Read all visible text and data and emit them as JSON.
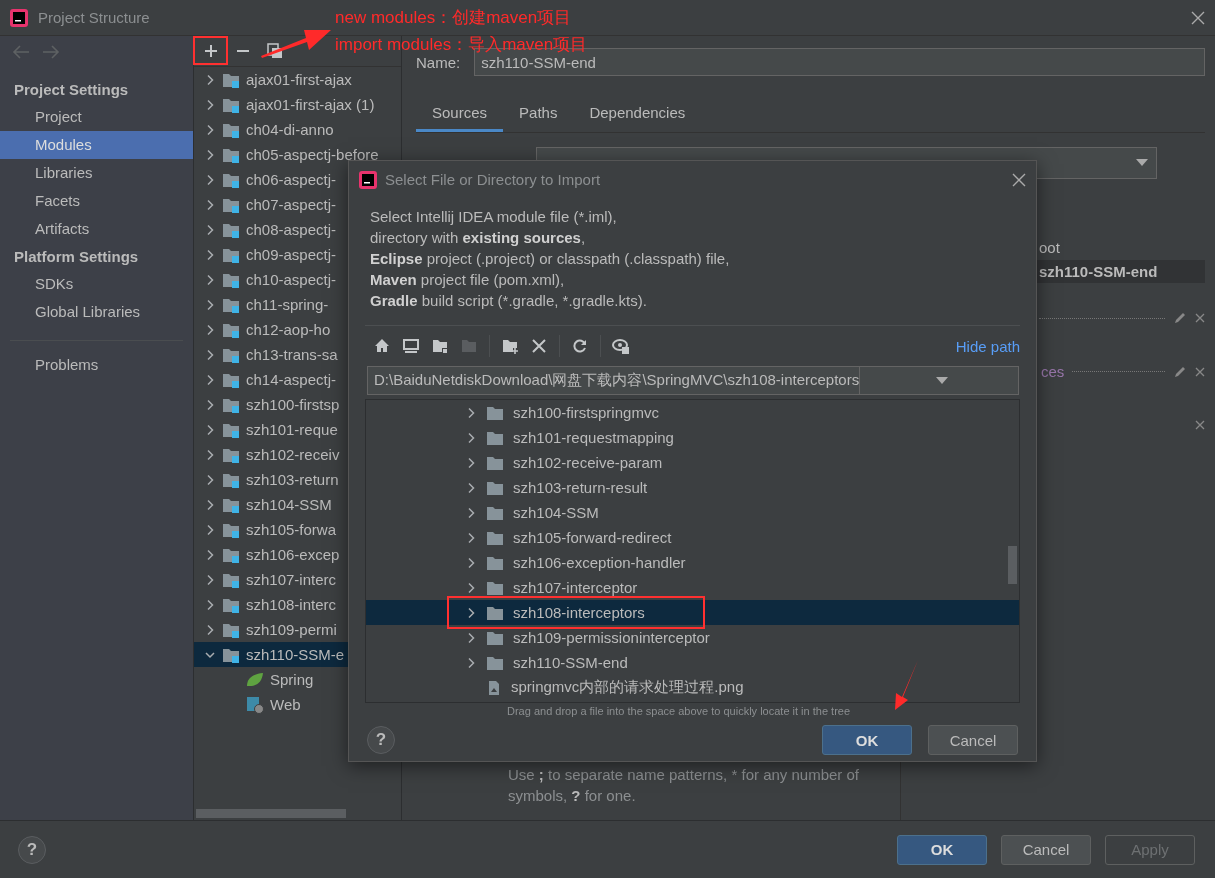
{
  "window": {
    "title": "Project Structure"
  },
  "annotations": [
    "new modules：创建maven项目",
    "import modules：导入maven项目"
  ],
  "sidebar": {
    "groups": [
      {
        "heading": "Project Settings",
        "items": [
          {
            "label": "Project",
            "selected": false
          },
          {
            "label": "Modules",
            "selected": true
          },
          {
            "label": "Libraries",
            "selected": false
          },
          {
            "label": "Facets",
            "selected": false
          },
          {
            "label": "Artifacts",
            "selected": false
          }
        ]
      },
      {
        "heading": "Platform Settings",
        "items": [
          {
            "label": "SDKs",
            "selected": false
          },
          {
            "label": "Global Libraries",
            "selected": false
          }
        ]
      }
    ],
    "footer_items": [
      {
        "label": "Problems",
        "selected": false
      }
    ]
  },
  "module_tree": {
    "items": [
      {
        "label": "ajax01-first-ajax",
        "expanded": false,
        "selected": false
      },
      {
        "label": "ajax01-first-ajax (1)",
        "expanded": false,
        "selected": false
      },
      {
        "label": "ch04-di-anno",
        "expanded": false,
        "selected": false
      },
      {
        "label": "ch05-aspectj-before",
        "expanded": false,
        "selected": false
      },
      {
        "label": "ch06-aspectj-",
        "expanded": false,
        "selected": false
      },
      {
        "label": "ch07-aspectj-",
        "expanded": false,
        "selected": false
      },
      {
        "label": "ch08-aspectj-",
        "expanded": false,
        "selected": false
      },
      {
        "label": "ch09-aspectj-",
        "expanded": false,
        "selected": false
      },
      {
        "label": "ch10-aspectj-",
        "expanded": false,
        "selected": false
      },
      {
        "label": "ch11-spring-",
        "expanded": false,
        "selected": false
      },
      {
        "label": "ch12-aop-ho",
        "expanded": false,
        "selected": false
      },
      {
        "label": "ch13-trans-sa",
        "expanded": false,
        "selected": false
      },
      {
        "label": "ch14-aspectj-",
        "expanded": false,
        "selected": false
      },
      {
        "label": "szh100-firstsp",
        "expanded": false,
        "selected": false
      },
      {
        "label": "szh101-reque",
        "expanded": false,
        "selected": false
      },
      {
        "label": "szh102-receiv",
        "expanded": false,
        "selected": false
      },
      {
        "label": "szh103-return",
        "expanded": false,
        "selected": false
      },
      {
        "label": "szh104-SSM",
        "expanded": false,
        "selected": false
      },
      {
        "label": "szh105-forwa",
        "expanded": false,
        "selected": false
      },
      {
        "label": "szh106-excep",
        "expanded": false,
        "selected": false
      },
      {
        "label": "szh107-interc",
        "expanded": false,
        "selected": false
      },
      {
        "label": "szh108-interc",
        "expanded": false,
        "selected": false
      },
      {
        "label": "szh109-permi",
        "expanded": false,
        "selected": false
      },
      {
        "label": "szh110-SSM-e",
        "expanded": true,
        "selected": true,
        "children": [
          {
            "label": "Spring",
            "kind": "spring"
          },
          {
            "label": "Web",
            "kind": "web"
          }
        ]
      }
    ]
  },
  "module_editor": {
    "name_label": "Name:",
    "name_value": "szh110-SSM-end",
    "tabs": [
      {
        "label": "Sources",
        "selected": true
      },
      {
        "label": "Paths",
        "selected": false
      },
      {
        "label": "Dependencies",
        "selected": false
      }
    ],
    "root_label": "oot",
    "root_path": "szh110-SSM-end",
    "folder_label": "ces",
    "hint": [
      {
        "text": "Use ",
        "bold": false
      },
      {
        "text": ";",
        "bold": true
      },
      {
        "text": " to separate name patterns, * for any number of symbols, ",
        "bold": false
      },
      {
        "text": "?",
        "bold": true
      },
      {
        "text": " for one.",
        "bold": false
      }
    ]
  },
  "dialog": {
    "title": "Select File or Directory to Import",
    "description": [
      [
        {
          "text": "Select Intellij IDEA module file (*.iml),",
          "bold": false
        }
      ],
      [
        {
          "text": "directory with ",
          "bold": false
        },
        {
          "text": "existing sources",
          "bold": true
        },
        {
          "text": ",",
          "bold": false
        }
      ],
      [
        {
          "text": "Eclipse",
          "bold": true
        },
        {
          "text": " project (.project) or classpath (.classpath) file,",
          "bold": false
        }
      ],
      [
        {
          "text": "Maven",
          "bold": true
        },
        {
          "text": " project file (pom.xml),",
          "bold": false
        }
      ],
      [
        {
          "text": "Gradle",
          "bold": true
        },
        {
          "text": " build script (*.gradle, *.gradle.kts).",
          "bold": false
        }
      ]
    ],
    "toolbar": [
      {
        "kind": "home",
        "disabled": false
      },
      {
        "kind": "desktop",
        "disabled": false
      },
      {
        "kind": "project",
        "disabled": false
      },
      {
        "kind": "module",
        "disabled": true
      },
      {
        "kind": "new-folder",
        "disabled": false
      },
      {
        "kind": "delete",
        "disabled": false
      },
      {
        "kind": "refresh",
        "disabled": false
      },
      {
        "kind": "hidden",
        "disabled": false
      }
    ],
    "hide_path": "Hide path",
    "path": "D:\\BaiduNetdiskDownload\\网盘下载内容\\SpringMVC\\szh108-interceptors",
    "items": [
      {
        "label": "szh100-firstspringmvc",
        "kind": "folder",
        "selected": false
      },
      {
        "label": "szh101-requestmapping",
        "kind": "folder",
        "selected": false
      },
      {
        "label": "szh102-receive-param",
        "kind": "folder",
        "selected": false
      },
      {
        "label": "szh103-return-result",
        "kind": "folder",
        "selected": false
      },
      {
        "label": "szh104-SSM",
        "kind": "folder",
        "selected": false
      },
      {
        "label": "szh105-forward-redirect",
        "kind": "folder",
        "selected": false
      },
      {
        "label": "szh106-exception-handler",
        "kind": "folder",
        "selected": false
      },
      {
        "label": "szh107-interceptor",
        "kind": "folder",
        "selected": false
      },
      {
        "label": "szh108-interceptors",
        "kind": "folder",
        "selected": true
      },
      {
        "label": "szh109-permissioninterceptor",
        "kind": "folder",
        "selected": false
      },
      {
        "label": "szh110-SSM-end",
        "kind": "folder",
        "selected": false
      },
      {
        "label": "springmvc内部的请求处理过程.png",
        "kind": "file",
        "selected": false
      }
    ],
    "drop_hint": "Drag and drop a file into the space above to quickly locate it in the tree",
    "help": "?",
    "buttons": [
      {
        "label": "OK",
        "kind": "primary",
        "disabled": false
      },
      {
        "label": "Cancel",
        "kind": "normal",
        "disabled": false
      }
    ]
  },
  "help": "?",
  "buttons": [
    {
      "label": "OK",
      "kind": "primary",
      "disabled": false
    },
    {
      "label": "Cancel",
      "kind": "normal",
      "disabled": false
    },
    {
      "label": "Apply",
      "kind": "normal",
      "disabled": true
    }
  ]
}
